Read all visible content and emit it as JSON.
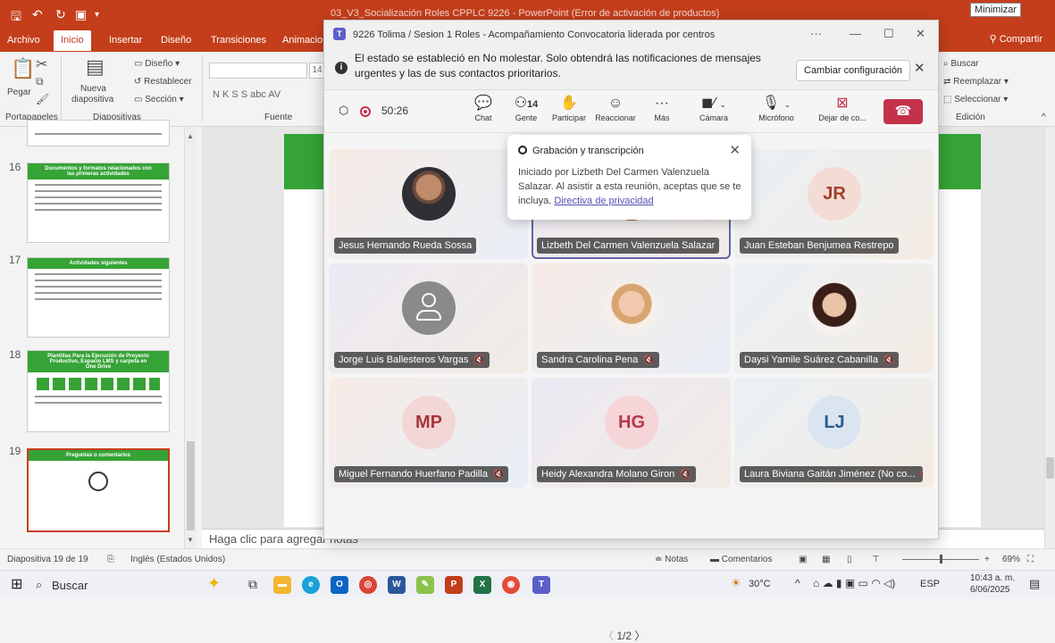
{
  "ppt": {
    "title": "03_V3_Socialización Roles CPPLC 9226 - PowerPoint (Error de activación de productos)",
    "minimize_tooltip": "Minimizar",
    "share": "Compartir",
    "tabs": [
      "Archivo",
      "Inicio",
      "Insertar",
      "Diseño",
      "Transiciones",
      "Animacio"
    ],
    "ribbon": {
      "pegar": "Pegar",
      "portapapeles": "Portapapeles",
      "nueva_diapositiva": "Nueva",
      "nueva_diapositiva2": "diapositiva",
      "diseno": "Diseño",
      "restablecer": "Restablecer",
      "seccion": "Sección",
      "diapositivas": "Diapositivas",
      "font_size": "14",
      "fuente": "Fuente",
      "format_buttons": "N  K  S  S  abc  AV",
      "buscar": "Buscar",
      "reemplazar": "Reemplazar",
      "seleccionar": "Seleccionar",
      "edicion": "Edición"
    },
    "thumbnails": [
      {
        "num": "16",
        "title": "Documentos y formatos relacionados con las primeras actividades"
      },
      {
        "num": "17",
        "title": "Actividades siguientes"
      },
      {
        "num": "18",
        "title": "Plantillas Para la Ejecución de Proyecto Productivo, Espacio LMS y carpeta en One Drive"
      },
      {
        "num": "19",
        "title": "Preguntas o comentarios"
      }
    ],
    "notes_placeholder": "Haga clic para agregar notas",
    "status": {
      "slide": "Diapositiva 19 de 19",
      "language": "Inglés (Estados Unidos)",
      "notas": "Notas",
      "comentarios": "Comentarios",
      "zoom": "69%"
    }
  },
  "teams": {
    "window_title": "9226 Tolima / Sesion 1 Roles - Acompañamiento Convocatoria liderada por centros",
    "dnd_message": "El estado se estableció en No molestar. Solo obtendrá las notificaciones de mensajes urgentes y las de sus contactos prioritarios.",
    "dnd_button": "Cambiar configuración",
    "timer": "50:26",
    "people_count": "14",
    "tools": [
      {
        "label": "Chat",
        "icon": "chat-icon"
      },
      {
        "label": "Gente",
        "icon": "people-icon"
      },
      {
        "label": "Participar",
        "icon": "raise-hand-icon"
      },
      {
        "label": "Reaccionar",
        "icon": "emoji-icon"
      },
      {
        "label": "Más",
        "icon": "more-icon"
      },
      {
        "label": "Cámara",
        "icon": "camera-off-icon"
      },
      {
        "label": "Micrófono",
        "icon": "mic-icon"
      },
      {
        "label": "Dejar de co...",
        "icon": "stop-share-icon"
      }
    ],
    "recording_popup": {
      "title": "Grabación y transcripción",
      "body": "Iniciado por Lizbeth Del Carmen Valenzuela Salazar. Al asistir a esta reunión, aceptas que se te incluya.",
      "link": "Directiva de privacidad"
    },
    "participants": [
      {
        "name": "Jesus Hernando Rueda Sossa",
        "initials": "",
        "muted": false
      },
      {
        "name": "Lizbeth Del Carmen Valenzuela Salazar",
        "initials": "",
        "muted": false
      },
      {
        "name": "Juan Esteban Benjumea Restrepo",
        "initials": "JR",
        "muted": false
      },
      {
        "name": "Jorge Luis Ballesteros Vargas",
        "initials": "",
        "muted": true
      },
      {
        "name": "Sandra Carolina Pena",
        "initials": "",
        "muted": true
      },
      {
        "name": "Daysi Yamile Suárez Cabanilla",
        "initials": "",
        "muted": true
      },
      {
        "name": "Miguel Fernando Huerfano Padilla",
        "initials": "MP",
        "muted": true
      },
      {
        "name": "Heidy Alexandra Molano Giron",
        "initials": "HG",
        "muted": true
      },
      {
        "name": "Laura Biviana Gaitán Jiménez (No co...",
        "initials": "LJ",
        "muted": true
      }
    ],
    "pager": "1/2"
  },
  "taskbar": {
    "search": "Buscar",
    "weather": "30°C",
    "lang": "ESP",
    "time": "10:43 a. m.",
    "date": "6/06/2025"
  },
  "colors": {
    "ppt_accent": "#c43e1c",
    "teams_accent": "#6264a7",
    "hangup": "#c4314b",
    "slide_green": "#35a336"
  }
}
